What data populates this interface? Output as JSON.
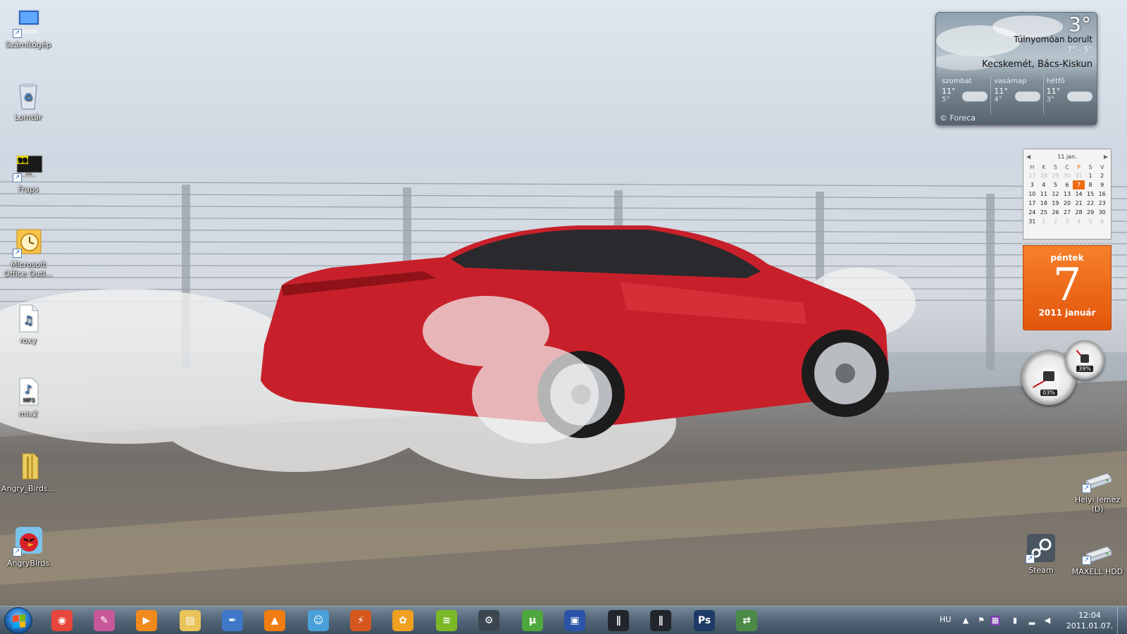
{
  "desktop": {
    "icons_left": [
      {
        "label": "Számítógép",
        "icon": "computer-icon"
      },
      {
        "label": "Lomtár",
        "icon": "recycle-bin-icon"
      },
      {
        "label": "Fraps",
        "icon": "fraps-icon"
      },
      {
        "label": "Microsoft Office Outl...",
        "icon": "outlook-icon"
      },
      {
        "label": "roxy",
        "icon": "audio-file-icon"
      },
      {
        "label": "mix2",
        "icon": "mp3-file-icon"
      },
      {
        "label": "Angry_Birds...",
        "icon": "folder-icon"
      },
      {
        "label": "AngryBirds",
        "icon": "angry-birds-icon"
      }
    ],
    "icons_right": [
      {
        "label": "Helyi lemez (D)",
        "icon": "drive-icon"
      },
      {
        "label": "Steam",
        "icon": "steam-icon"
      },
      {
        "label": "MAXELL HDD",
        "icon": "drive-icon"
      }
    ]
  },
  "weather": {
    "temp": "3°",
    "condition": "Túlnyomóan borult",
    "range": "7° - 5°",
    "city": "Kecskemét, Bács-Kiskun",
    "forecast": [
      {
        "day": "szombat",
        "hi": "11°",
        "lo": "5°"
      },
      {
        "day": "vasárnap",
        "hi": "11°",
        "lo": "4°"
      },
      {
        "day": "hétfő",
        "hi": "11°",
        "lo": "3°"
      }
    ],
    "brand": "© Foreca"
  },
  "calendar": {
    "month_title": "11 jan.",
    "weekdays": [
      "H",
      "K",
      "S",
      "C",
      "P",
      "S",
      "V"
    ],
    "weeks": [
      [
        "27",
        "28",
        "29",
        "30",
        "31",
        "1",
        "2"
      ],
      [
        "3",
        "4",
        "5",
        "6",
        "7",
        "8",
        "9"
      ],
      [
        "10",
        "11",
        "12",
        "13",
        "14",
        "15",
        "16"
      ],
      [
        "17",
        "18",
        "19",
        "20",
        "21",
        "22",
        "23"
      ],
      [
        "24",
        "25",
        "26",
        "27",
        "28",
        "29",
        "30"
      ],
      [
        "31",
        "1",
        "2",
        "3",
        "4",
        "5",
        "6"
      ]
    ],
    "weekday_name": "péntek",
    "day_number": "7",
    "year_month": "2011 január"
  },
  "meters": {
    "cpu": "03%",
    "memory": "39%"
  },
  "taskbar": {
    "apps": [
      {
        "name": "chrome-icon",
        "glyph": "◉",
        "color": "#e8453c"
      },
      {
        "name": "pen-app-icon",
        "glyph": "✎",
        "color": "#c8579a"
      },
      {
        "name": "media-player-icon",
        "glyph": "▶",
        "color": "#f08a1c"
      },
      {
        "name": "explorer-icon",
        "glyph": "▤",
        "color": "#e9c45a"
      },
      {
        "name": "writer-icon",
        "glyph": "✒",
        "color": "#3f78c6"
      },
      {
        "name": "vlc-icon",
        "glyph": "▲",
        "color": "#f07d12"
      },
      {
        "name": "messenger-icon",
        "glyph": "☺",
        "color": "#4aa0d8"
      },
      {
        "name": "winamp-icon",
        "glyph": "⚡",
        "color": "#d4581e"
      },
      {
        "name": "butterfly-app-icon",
        "glyph": "✿",
        "color": "#f0a020"
      },
      {
        "name": "spotify-icon",
        "glyph": "≋",
        "color": "#7bb928"
      },
      {
        "name": "steam-icon",
        "glyph": "⚙",
        "color": "#3c4651"
      },
      {
        "name": "utorrent-icon",
        "glyph": "µ",
        "color": "#4fa83d"
      },
      {
        "name": "save-app-icon",
        "glyph": "▣",
        "color": "#2b53a8"
      },
      {
        "name": "perf-app-icon",
        "glyph": "∥",
        "color": "#22262c"
      },
      {
        "name": "perf-app-2-icon",
        "glyph": "∥",
        "color": "#22262c"
      },
      {
        "name": "photoshop-icon",
        "glyph": "Ps",
        "color": "#1d3b66"
      },
      {
        "name": "network-app-icon",
        "glyph": "⇄",
        "color": "#4a8a46"
      }
    ],
    "language": "HU",
    "time": "12:04",
    "date": "2011.01.07."
  }
}
